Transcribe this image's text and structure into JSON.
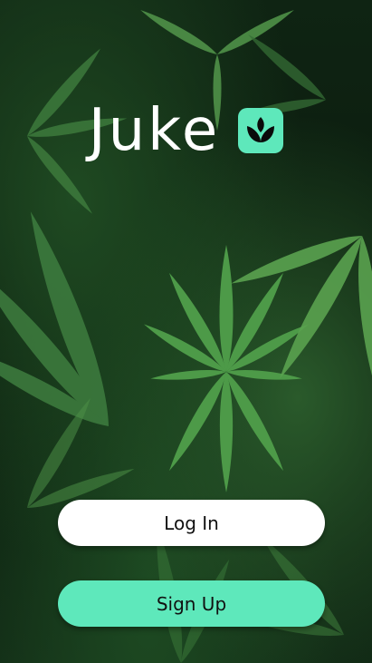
{
  "app": {
    "name": "Juke",
    "logo_icon": "leaf-icon",
    "brand_color": "#5ee8bb"
  },
  "background": {
    "description_icon": "cannabis-leaves-background"
  },
  "actions": {
    "login_label": "Log In",
    "signup_label": "Sign Up"
  },
  "colors": {
    "login_button": "#ffffff",
    "signup_button": "#5ee8bb",
    "text": "#111111"
  }
}
